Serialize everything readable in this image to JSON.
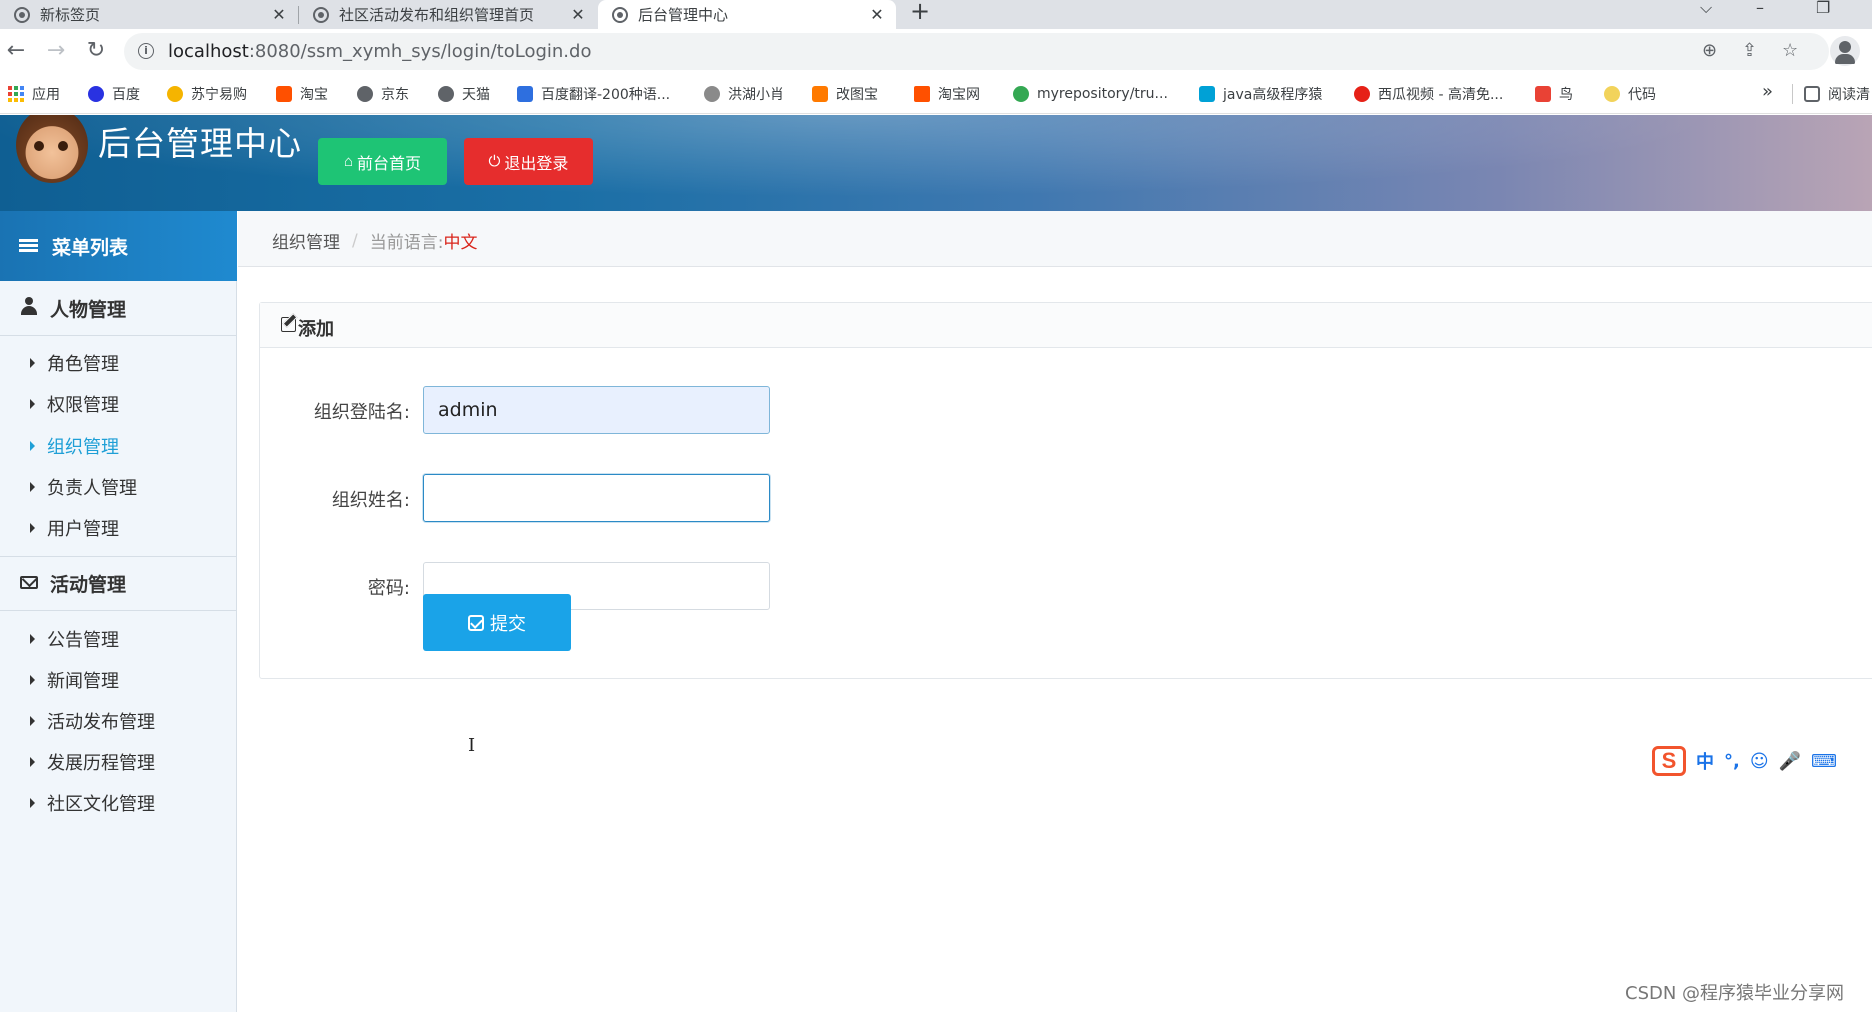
{
  "browser": {
    "tabs": [
      {
        "title": "新标签页"
      },
      {
        "title": "社区活动发布和组织管理首页"
      },
      {
        "title": "后台管理中心"
      }
    ],
    "url_host": "localhost",
    "url_path": ":8080/ssm_xymh_sys/login/toLogin.do",
    "bookmarks": [
      {
        "label": "应用",
        "color": "#e94235"
      },
      {
        "label": "百度",
        "color": "#2932e1"
      },
      {
        "label": "苏宁易购",
        "color": "#f5b400"
      },
      {
        "label": "淘宝",
        "color": "#ff5000"
      },
      {
        "label": "京东",
        "color": "#5f6368"
      },
      {
        "label": "天猫",
        "color": "#5f6368"
      },
      {
        "label": "百度翻译-200种语...",
        "color": "#2e6fdf"
      },
      {
        "label": "洪湖小肖",
        "color": "#8a8a8a"
      },
      {
        "label": "改图宝",
        "color": "#ff7a00"
      },
      {
        "label": "淘宝网",
        "color": "#ff5000"
      },
      {
        "label": "myrepository/tru...",
        "color": "#34a853"
      },
      {
        "label": "java高级程序猿",
        "color": "#00a1d6"
      },
      {
        "label": "西瓜视频 - 高清免...",
        "color": "#e62117"
      },
      {
        "label": "鸟",
        "color": "#e94235"
      },
      {
        "label": "代码",
        "color": "#f2d35b"
      },
      {
        "label": "阅读清",
        "color": "#5f6368"
      }
    ]
  },
  "header": {
    "title": "后台管理中心",
    "home_label": "前台首页",
    "logout_label": "退出登录",
    "home_color": "#1ec475",
    "logout_color": "#e62d2d"
  },
  "sidebar": {
    "title": "菜单列表",
    "groups": [
      {
        "title": "人物管理",
        "icon": "user-icon",
        "items": [
          {
            "label": "角色管理"
          },
          {
            "label": "权限管理"
          },
          {
            "label": "组织管理",
            "active": true
          },
          {
            "label": "负责人管理"
          },
          {
            "label": "用户管理"
          }
        ]
      },
      {
        "title": "活动管理",
        "icon": "envelope-icon",
        "items": [
          {
            "label": "公告管理"
          },
          {
            "label": "新闻管理"
          },
          {
            "label": "活动发布管理"
          },
          {
            "label": "发展历程管理"
          },
          {
            "label": "社区文化管理"
          }
        ]
      }
    ]
  },
  "breadcrumb": {
    "current": "组织管理",
    "lang_label": "当前语言:",
    "lang_value": "中文"
  },
  "form": {
    "panel_title": "添加",
    "fields": [
      {
        "label": "组织登陆名:",
        "value": "admin"
      },
      {
        "label": "组织姓名:",
        "value": ""
      },
      {
        "label": "密码:",
        "value": ""
      }
    ],
    "submit_label": "提交"
  },
  "ime": {
    "logo": "S",
    "items": [
      "中",
      "°,",
      "☺",
      "🎤",
      "⌨"
    ]
  },
  "watermark": "CSDN @程序猿毕业分享网"
}
